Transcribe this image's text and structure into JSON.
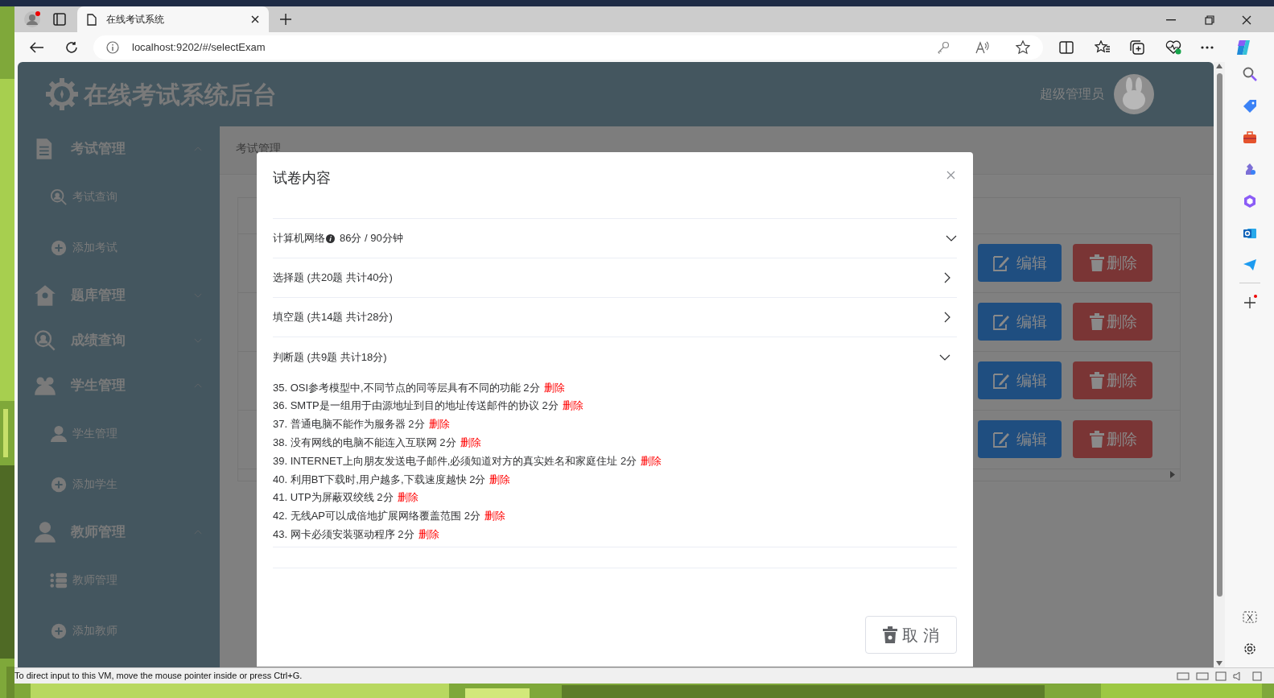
{
  "browser": {
    "tab_title": "在线考试系统",
    "url": "localhost:9202/#/selectExam"
  },
  "app": {
    "title": "在线考试系统后台",
    "user": "超级管理员"
  },
  "sidebar": {
    "groups": [
      {
        "label": "考试管理",
        "expanded": true,
        "children": [
          {
            "label": "考试查询"
          },
          {
            "label": "添加考试"
          }
        ]
      },
      {
        "label": "题库管理",
        "expanded": false
      },
      {
        "label": "成绩查询",
        "expanded": false
      },
      {
        "label": "学生管理",
        "expanded": true,
        "children": [
          {
            "label": "学生管理"
          },
          {
            "label": "添加学生"
          }
        ]
      },
      {
        "label": "教师管理",
        "expanded": true,
        "children": [
          {
            "label": "教师管理"
          },
          {
            "label": "添加教师"
          }
        ]
      }
    ]
  },
  "breadcrumb": "考试管理",
  "table": {
    "rows": [
      {
        "edit": "编辑",
        "delete": "删除"
      },
      {
        "edit": "编辑",
        "delete": "删除"
      },
      {
        "edit": "编辑",
        "delete": "删除"
      },
      {
        "edit": "编辑",
        "delete": "删除"
      }
    ]
  },
  "modal": {
    "title": "试卷内容",
    "exam": {
      "name": "计算机网络",
      "info": "86分 / 90分钟",
      "expanded": true
    },
    "sections": [
      {
        "title": "选择题 (共20题 共计40分)",
        "expanded": false
      },
      {
        "title": "填空题 (共14题 共计28分)",
        "expanded": false
      },
      {
        "title": "判断题 (共9题 共计18分)",
        "expanded": true,
        "items": [
          {
            "text": "35. OSI参考模型中,不同节点的同等层具有不同的功能 2分",
            "action": "删除"
          },
          {
            "text": "36. SMTP是一组用于由源地址到目的地址传送邮件的协议 2分",
            "action": "删除"
          },
          {
            "text": "37. 普通电脑不能作为服务器 2分",
            "action": "删除"
          },
          {
            "text": "38. 没有网线的电脑不能连入互联网 2分",
            "action": "删除"
          },
          {
            "text": "39. INTERNET上向朋友发送电子邮件,必须知道对方的真实姓名和家庭住址 2分",
            "action": "删除"
          },
          {
            "text": "40. 利用BT下载时,用户越多,下载速度越快 2分",
            "action": "删除"
          },
          {
            "text": "41. UTP为屏蔽双绞线 2分",
            "action": "删除"
          },
          {
            "text": "42. 无线AP可以成倍地扩展网络覆盖范围 2分",
            "action": "删除"
          },
          {
            "text": "43. 网卡必须安装驱动程序 2分",
            "action": "删除"
          }
        ]
      }
    ],
    "cancel": "取 消"
  },
  "status_bar": "To direct input to this VM, move the mouse pointer inside or press Ctrl+G."
}
